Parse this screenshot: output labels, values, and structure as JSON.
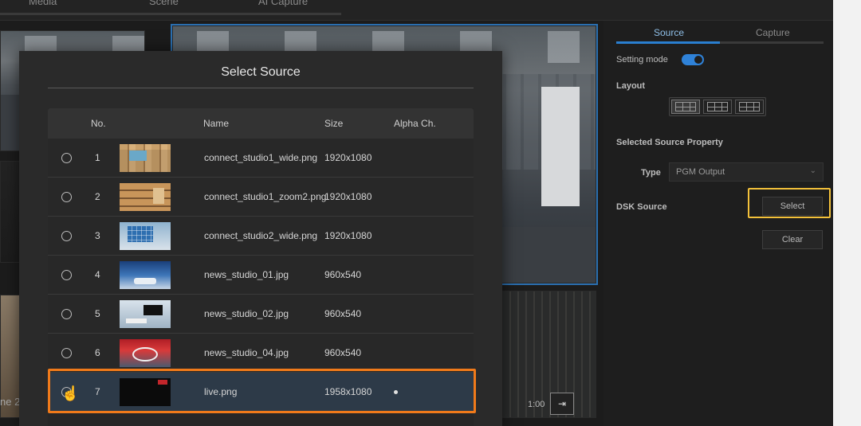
{
  "topbar": {
    "tabs": [
      "Media",
      "Scene",
      "AI Capture"
    ]
  },
  "background": {
    "side_text": "ne 2",
    "time_label": "1:00",
    "exit_icon": "exit-icon"
  },
  "panel": {
    "tabs": [
      "Source",
      "Capture"
    ],
    "setting_mode_label": "Setting mode",
    "setting_mode_on": true,
    "layout_label": "Layout",
    "layout_options": [
      "grid-3x3-icon",
      "grid-2x3-icon",
      "grid-2x2-icon"
    ],
    "selected_source_property_label": "Selected Source Property",
    "type_label": "Type",
    "type_value": "PGM Output",
    "dsk_source_label": "DSK Source",
    "select_button": "Select",
    "clear_button": "Clear"
  },
  "modal": {
    "title": "Select Source",
    "columns": [
      "No.",
      "Name",
      "Size",
      "Alpha Ch."
    ],
    "rows": [
      {
        "no": "1",
        "name": "connect_studio1_wide.png",
        "size": "1920x1080",
        "alpha": false
      },
      {
        "no": "2",
        "name": "connect_studio1_zoom2.png",
        "size": "1920x1080",
        "alpha": false
      },
      {
        "no": "3",
        "name": "connect_studio2_wide.png",
        "size": "1920x1080",
        "alpha": false
      },
      {
        "no": "4",
        "name": "news_studio_01.jpg",
        "size": "960x540",
        "alpha": false
      },
      {
        "no": "5",
        "name": "news_studio_02.jpg",
        "size": "960x540",
        "alpha": false
      },
      {
        "no": "6",
        "name": "news_studio_04.jpg",
        "size": "960x540",
        "alpha": false
      },
      {
        "no": "7",
        "name": "live.png",
        "size": "1958x1080",
        "alpha": true
      }
    ],
    "selected_row": 7
  },
  "colors": {
    "accent_blue": "#2a7fd0",
    "highlight_yellow": "#f3c13a",
    "highlight_orange": "#f07a1a"
  }
}
